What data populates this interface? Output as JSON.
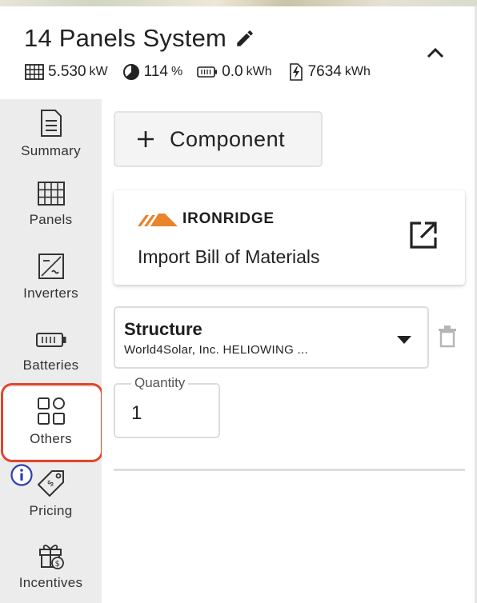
{
  "header": {
    "title": "14 Panels System",
    "stats": {
      "power": {
        "value": "5.530",
        "unit": "kW"
      },
      "offset": {
        "value": "114",
        "unit": "%"
      },
      "battery": {
        "value": "0.0",
        "unit": "kWh"
      },
      "production": {
        "value": "7634",
        "unit": "kWh"
      }
    }
  },
  "sidebar": {
    "items": [
      {
        "label": "Summary",
        "icon": "document-icon"
      },
      {
        "label": "Panels",
        "icon": "solar-panel-icon"
      },
      {
        "label": "Inverters",
        "icon": "inverter-icon"
      },
      {
        "label": "Batteries",
        "icon": "battery-icon"
      },
      {
        "label": "Others",
        "icon": "grid-shapes-icon",
        "active": true
      },
      {
        "label": "Pricing",
        "icon": "price-tag-icon"
      },
      {
        "label": "Incentives",
        "icon": "gift-icon"
      }
    ]
  },
  "main": {
    "add_component_label": "Component",
    "import_card": {
      "brand": "IRONRIDGE",
      "label": "Import Bill of Materials"
    },
    "component": {
      "category": "Structure",
      "product": "World4Solar, Inc. HELIOWING ..."
    },
    "quantity": {
      "label": "Quantity",
      "value": "1"
    }
  },
  "colors": {
    "highlight": "#e2462c",
    "brand_orange": "#e8842c",
    "info_blue": "#2b3fb0",
    "sidebar_bg": "#ececec"
  }
}
